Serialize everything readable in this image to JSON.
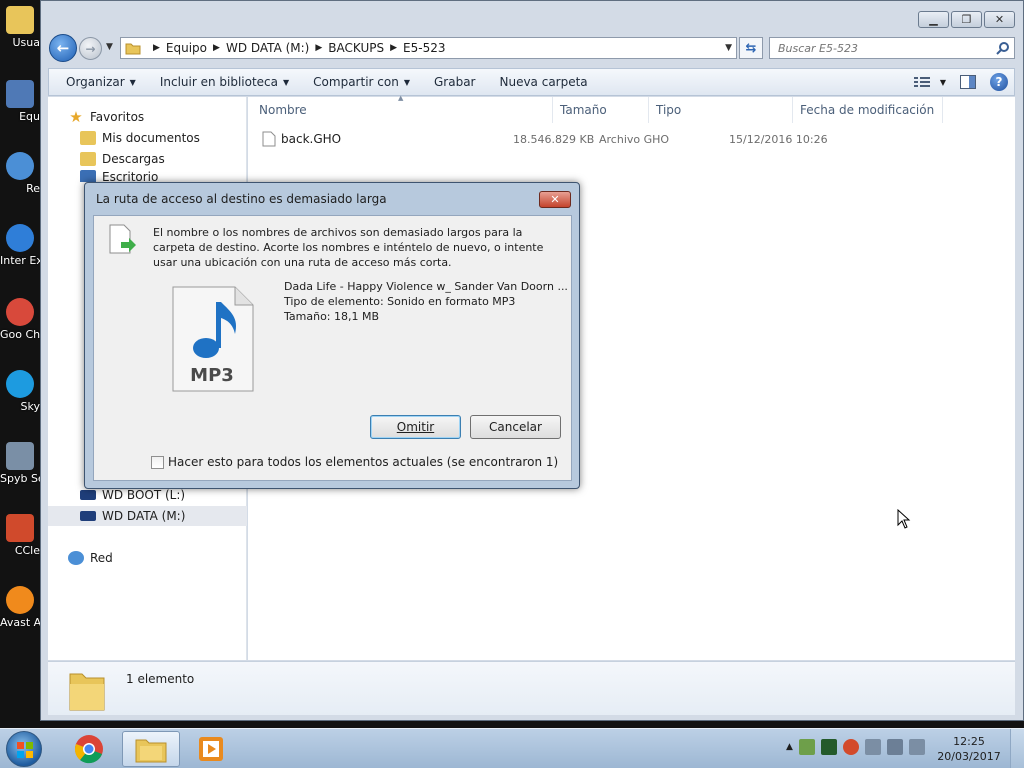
{
  "desktop": {
    "icons": [
      {
        "label": "Usua",
        "color": "#e8c55a"
      },
      {
        "label": "Equ",
        "color": "#4f79b6"
      },
      {
        "label": "Re",
        "color": "#4b8fd6"
      },
      {
        "label": "Inter Explo",
        "color": "#2f7ed8"
      },
      {
        "label": "Goo Chro",
        "color": "#d8493b"
      },
      {
        "label": "Sky",
        "color": "#1d9be0"
      },
      {
        "label": "Spyb Searc",
        "color": "#7a8fa6"
      },
      {
        "label": "CCle",
        "color": "#d04a2c"
      },
      {
        "label": "Avast Antiv",
        "color": "#f08a1c"
      }
    ]
  },
  "explorer": {
    "breadcrumb": [
      "Equipo",
      "WD DATA (M:)",
      "BACKUPS",
      "E5-523"
    ],
    "search_placeholder": "Buscar E5-523",
    "toolbar": {
      "organize": "Organizar",
      "include_library": "Incluir en biblioteca",
      "share_with": "Compartir con",
      "burn": "Grabar",
      "new_folder": "Nueva carpeta"
    },
    "nav_pane": {
      "favorites": "Favoritos",
      "my_documents": "Mis documentos",
      "downloads": "Descargas",
      "desktop": "Escritorio",
      "wd_boot": "WD BOOT (L:)",
      "wd_data": "WD DATA (M:)",
      "network": "Red"
    },
    "columns": {
      "name": "Nombre",
      "size": "Tamaño",
      "type": "Tipo",
      "modified": "Fecha de modificación"
    },
    "files": [
      {
        "name": "back.GHO",
        "size": "18.546.829 KB",
        "type": "Archivo GHO",
        "modified": "15/12/2016 10:26"
      }
    ],
    "status": "1 elemento"
  },
  "dialog": {
    "title": "La ruta de acceso al destino es demasiado larga",
    "close_label": "✕",
    "message": "El nombre o los nombres de archivos son demasiado largos para la carpeta de destino. Acorte los nombres e inténtelo de nuevo, o intente usar una ubicación con una ruta de acceso más corta.",
    "file_name": "Dada Life - Happy Violence w_ Sander Van Doorn ...",
    "file_type": "Tipo de elemento: Sonido en formato MP3",
    "file_size": "Tamaño: 18,1 MB",
    "file_icon_text": "MP3",
    "skip_button": "Omitir",
    "cancel_button": "Cancelar",
    "apply_all_label": "Hacer esto para todos los elementos actuales (se encontraron 1)"
  },
  "taskbar": {
    "time": "12:25",
    "date": "20/03/2017"
  }
}
